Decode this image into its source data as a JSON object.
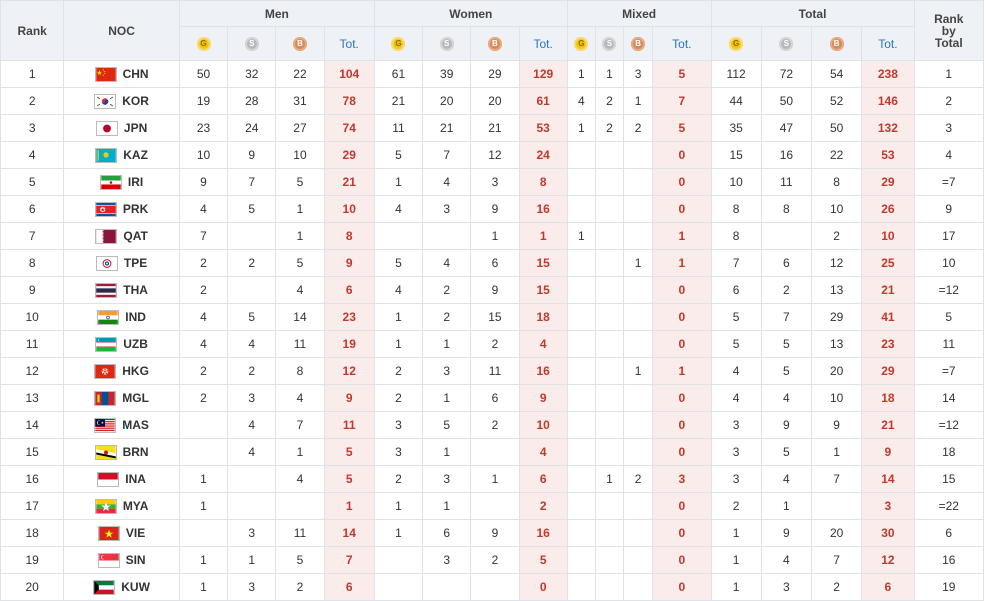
{
  "headers": {
    "rank": "Rank",
    "noc": "NOC",
    "groups": [
      "Men",
      "Women",
      "Mixed",
      "Total"
    ],
    "rank_by_total": [
      "Rank",
      "by",
      "Total"
    ],
    "medal_letters": [
      "G",
      "S",
      "B"
    ],
    "tot": "Tot."
  },
  "colors": {
    "gold": "#f1c40f",
    "silver": "#b8b8b8",
    "bronze": "#d4895a",
    "total_text": "#c0392b",
    "total_bg": "#fbecec"
  },
  "rows": [
    {
      "rank": "1",
      "noc": "CHN",
      "flag": "chn-flag",
      "men": [
        "50",
        "32",
        "22",
        "104"
      ],
      "women": [
        "61",
        "39",
        "29",
        "129"
      ],
      "mixed": [
        "1",
        "1",
        "3",
        "5"
      ],
      "total": [
        "112",
        "72",
        "54",
        "238"
      ],
      "rbt": "1"
    },
    {
      "rank": "2",
      "noc": "KOR",
      "flag": "kor-flag",
      "men": [
        "19",
        "28",
        "31",
        "78"
      ],
      "women": [
        "21",
        "20",
        "20",
        "61"
      ],
      "mixed": [
        "4",
        "2",
        "1",
        "7"
      ],
      "total": [
        "44",
        "50",
        "52",
        "146"
      ],
      "rbt": "2"
    },
    {
      "rank": "3",
      "noc": "JPN",
      "flag": "jpn-flag",
      "men": [
        "23",
        "24",
        "27",
        "74"
      ],
      "women": [
        "11",
        "21",
        "21",
        "53"
      ],
      "mixed": [
        "1",
        "2",
        "2",
        "5"
      ],
      "total": [
        "35",
        "47",
        "50",
        "132"
      ],
      "rbt": "3"
    },
    {
      "rank": "4",
      "noc": "KAZ",
      "flag": "kaz-flag",
      "men": [
        "10",
        "9",
        "10",
        "29"
      ],
      "women": [
        "5",
        "7",
        "12",
        "24"
      ],
      "mixed": [
        "",
        "",
        "",
        "0"
      ],
      "total": [
        "15",
        "16",
        "22",
        "53"
      ],
      "rbt": "4"
    },
    {
      "rank": "5",
      "noc": "IRI",
      "flag": "iri-flag",
      "men": [
        "9",
        "7",
        "5",
        "21"
      ],
      "women": [
        "1",
        "4",
        "3",
        "8"
      ],
      "mixed": [
        "",
        "",
        "",
        "0"
      ],
      "total": [
        "10",
        "11",
        "8",
        "29"
      ],
      "rbt": "=7"
    },
    {
      "rank": "6",
      "noc": "PRK",
      "flag": "prk-flag",
      "men": [
        "4",
        "5",
        "1",
        "10"
      ],
      "women": [
        "4",
        "3",
        "9",
        "16"
      ],
      "mixed": [
        "",
        "",
        "",
        "0"
      ],
      "total": [
        "8",
        "8",
        "10",
        "26"
      ],
      "rbt": "9"
    },
    {
      "rank": "7",
      "noc": "QAT",
      "flag": "qat-flag",
      "men": [
        "7",
        "",
        "1",
        "8"
      ],
      "women": [
        "",
        "",
        "1",
        "1"
      ],
      "mixed": [
        "1",
        "",
        "",
        "1"
      ],
      "total": [
        "8",
        "",
        "2",
        "10"
      ],
      "rbt": "17"
    },
    {
      "rank": "8",
      "noc": "TPE",
      "flag": "tpe-flag",
      "men": [
        "2",
        "2",
        "5",
        "9"
      ],
      "women": [
        "5",
        "4",
        "6",
        "15"
      ],
      "mixed": [
        "",
        "",
        "1",
        "1"
      ],
      "total": [
        "7",
        "6",
        "12",
        "25"
      ],
      "rbt": "10"
    },
    {
      "rank": "9",
      "noc": "THA",
      "flag": "tha-flag",
      "men": [
        "2",
        "",
        "4",
        "6"
      ],
      "women": [
        "4",
        "2",
        "9",
        "15"
      ],
      "mixed": [
        "",
        "",
        "",
        "0"
      ],
      "total": [
        "6",
        "2",
        "13",
        "21"
      ],
      "rbt": "=12"
    },
    {
      "rank": "10",
      "noc": "IND",
      "flag": "ind-flag",
      "men": [
        "4",
        "5",
        "14",
        "23"
      ],
      "women": [
        "1",
        "2",
        "15",
        "18"
      ],
      "mixed": [
        "",
        "",
        "",
        "0"
      ],
      "total": [
        "5",
        "7",
        "29",
        "41"
      ],
      "rbt": "5"
    },
    {
      "rank": "11",
      "noc": "UZB",
      "flag": "uzb-flag",
      "men": [
        "4",
        "4",
        "11",
        "19"
      ],
      "women": [
        "1",
        "1",
        "2",
        "4"
      ],
      "mixed": [
        "",
        "",
        "",
        "0"
      ],
      "total": [
        "5",
        "5",
        "13",
        "23"
      ],
      "rbt": "11"
    },
    {
      "rank": "12",
      "noc": "HKG",
      "flag": "hkg-flag",
      "men": [
        "2",
        "2",
        "8",
        "12"
      ],
      "women": [
        "2",
        "3",
        "11",
        "16"
      ],
      "mixed": [
        "",
        "",
        "1",
        "1"
      ],
      "total": [
        "4",
        "5",
        "20",
        "29"
      ],
      "rbt": "=7"
    },
    {
      "rank": "13",
      "noc": "MGL",
      "flag": "mgl-flag",
      "men": [
        "2",
        "3",
        "4",
        "9"
      ],
      "women": [
        "2",
        "1",
        "6",
        "9"
      ],
      "mixed": [
        "",
        "",
        "",
        "0"
      ],
      "total": [
        "4",
        "4",
        "10",
        "18"
      ],
      "rbt": "14"
    },
    {
      "rank": "14",
      "noc": "MAS",
      "flag": "mas-flag",
      "men": [
        "",
        "4",
        "7",
        "11"
      ],
      "women": [
        "3",
        "5",
        "2",
        "10"
      ],
      "mixed": [
        "",
        "",
        "",
        "0"
      ],
      "total": [
        "3",
        "9",
        "9",
        "21"
      ],
      "rbt": "=12"
    },
    {
      "rank": "15",
      "noc": "BRN",
      "flag": "brn-flag",
      "men": [
        "",
        "4",
        "1",
        "5"
      ],
      "women": [
        "3",
        "1",
        "",
        "4"
      ],
      "mixed": [
        "",
        "",
        "",
        "0"
      ],
      "total": [
        "3",
        "5",
        "1",
        "9"
      ],
      "rbt": "18"
    },
    {
      "rank": "16",
      "noc": "INA",
      "flag": "ina-flag",
      "men": [
        "1",
        "",
        "4",
        "5"
      ],
      "women": [
        "2",
        "3",
        "1",
        "6"
      ],
      "mixed": [
        "",
        "1",
        "2",
        "3"
      ],
      "total": [
        "3",
        "4",
        "7",
        "14"
      ],
      "rbt": "15"
    },
    {
      "rank": "17",
      "noc": "MYA",
      "flag": "mya-flag",
      "men": [
        "1",
        "",
        "",
        "1"
      ],
      "women": [
        "1",
        "1",
        "",
        "2"
      ],
      "mixed": [
        "",
        "",
        "",
        "0"
      ],
      "total": [
        "2",
        "1",
        "",
        "3"
      ],
      "rbt": "=22"
    },
    {
      "rank": "18",
      "noc": "VIE",
      "flag": "vie-flag",
      "men": [
        "",
        "3",
        "11",
        "14"
      ],
      "women": [
        "1",
        "6",
        "9",
        "16"
      ],
      "mixed": [
        "",
        "",
        "",
        "0"
      ],
      "total": [
        "1",
        "9",
        "20",
        "30"
      ],
      "rbt": "6"
    },
    {
      "rank": "19",
      "noc": "SIN",
      "flag": "sin-flag",
      "men": [
        "1",
        "1",
        "5",
        "7"
      ],
      "women": [
        "",
        "3",
        "2",
        "5"
      ],
      "mixed": [
        "",
        "",
        "",
        "0"
      ],
      "total": [
        "1",
        "4",
        "7",
        "12"
      ],
      "rbt": "16"
    },
    {
      "rank": "20",
      "noc": "KUW",
      "flag": "kuw-flag",
      "men": [
        "1",
        "3",
        "2",
        "6"
      ],
      "women": [
        "",
        "",
        "",
        "0"
      ],
      "mixed": [
        "",
        "",
        "",
        "0"
      ],
      "total": [
        "1",
        "3",
        "2",
        "6"
      ],
      "rbt": "19"
    }
  ]
}
